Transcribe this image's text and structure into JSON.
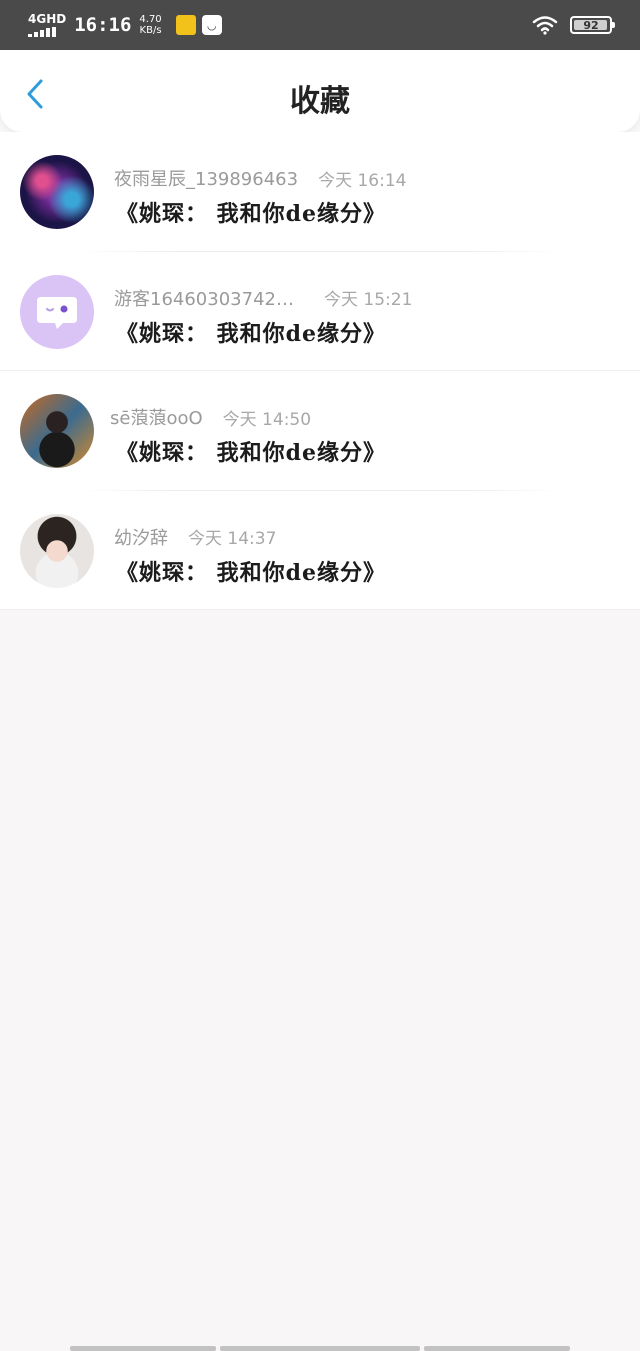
{
  "status_bar": {
    "network": "4GHD",
    "time": "16:16",
    "speed_value": "4.70",
    "speed_unit": "KB/s",
    "battery": "92"
  },
  "header": {
    "title": "收藏",
    "back_icon": "chevron-left-icon",
    "accent": "#2d9cdb"
  },
  "items": [
    {
      "name": "夜雨星辰_139896463",
      "time": "今天 16:14",
      "content": "《姚琛： 我和你de缘分》"
    },
    {
      "name": "游客164603037427···",
      "time": "今天 15:21",
      "content": "《姚琛： 我和你de缘分》"
    },
    {
      "name": "sē蒗蒗ooO",
      "time": "今天 14:50",
      "content": "《姚琛： 我和你de缘分》"
    },
    {
      "name": "幼汐辞",
      "time": "今天 14:37",
      "content": "《姚琛： 我和你de缘分》"
    }
  ]
}
